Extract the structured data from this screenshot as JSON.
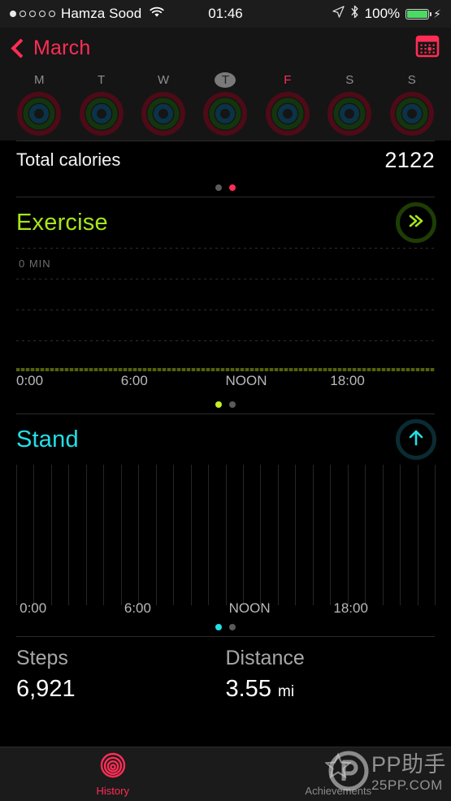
{
  "status_bar": {
    "signal_dots_filled": 1,
    "signal_dots_total": 5,
    "carrier": "Hamza Sood",
    "wifi_icon": "wifi-icon",
    "time": "01:46",
    "location_icon": "location-arrow-icon",
    "bluetooth_icon": "bluetooth-icon",
    "battery_percent": "100%",
    "battery_fill": 100,
    "battery_color": "#4cd964",
    "charging": true
  },
  "nav_bar": {
    "back_icon": "chevron-left-icon",
    "back_label": "March",
    "calendar_icon": "calendar-icon",
    "accent_color": "#ff2d55"
  },
  "week_strip": {
    "days": [
      {
        "letter": "M",
        "selected": false,
        "highlighted": false
      },
      {
        "letter": "T",
        "selected": false,
        "highlighted": false
      },
      {
        "letter": "W",
        "selected": false,
        "highlighted": false
      },
      {
        "letter": "T",
        "selected": true,
        "highlighted": false
      },
      {
        "letter": "F",
        "selected": false,
        "highlighted": true
      },
      {
        "letter": "S",
        "selected": false,
        "highlighted": false
      },
      {
        "letter": "S",
        "selected": false,
        "highlighted": false
      }
    ],
    "ring_track_colors": {
      "move": "#4d0a17",
      "exercise": "#13350d",
      "stand": "#0b3347"
    }
  },
  "move_section": {
    "total_label": "Total calories",
    "total_value": "2122",
    "page_dots": [
      {
        "active": false,
        "color": "#5a5a5a"
      },
      {
        "active": true,
        "color": "#ff2d55"
      }
    ]
  },
  "exercise_section": {
    "title": "Exercise",
    "title_color": "#a6e619",
    "badge_icon": "double-chevron-right-icon",
    "badge_color": "#a6e619",
    "zero_label": "0 MIN",
    "axis_labels": [
      "0:00",
      "6:00",
      "NOON",
      "18:00"
    ],
    "page_dots": [
      {
        "active": true,
        "color": "#c4f022"
      },
      {
        "active": false,
        "color": "#5a5a5a"
      }
    ]
  },
  "stand_section": {
    "title": "Stand",
    "title_color": "#22dfe6",
    "badge_icon": "arrow-up-icon",
    "badge_color": "#22dfe6",
    "axis_labels": [
      "0:00",
      "6:00",
      "NOON",
      "18:00"
    ],
    "page_dots": [
      {
        "active": true,
        "color": "#22dfe6"
      },
      {
        "active": false,
        "color": "#5a5a5a"
      }
    ]
  },
  "stats": [
    {
      "label": "Steps",
      "value": "6,921",
      "unit": ""
    },
    {
      "label": "Distance",
      "value": "3.55",
      "unit": "mi"
    }
  ],
  "tab_bar": {
    "tabs": [
      {
        "label": "History",
        "icon": "activity-spiral-icon",
        "active": true,
        "color": "#ff2d55"
      },
      {
        "label": "Achievements",
        "icon": "star-icon",
        "active": false,
        "color": "#8a8a8a"
      }
    ]
  },
  "watermark": {
    "logo_icon": "pp-logo-icon",
    "line1": "PP助手",
    "line2": "25PP.COM"
  },
  "chart_data": [
    {
      "type": "bar",
      "title": "Exercise",
      "xlabel": "",
      "ylabel": "MIN",
      "x": [
        "0:00",
        "6:00",
        "NOON",
        "18:00"
      ],
      "xlim": [
        0,
        24
      ],
      "ylim": [
        0,
        60
      ],
      "ytick_labels": [
        "0 MIN"
      ],
      "grid": true,
      "gridlines": 5,
      "values": [
        0,
        0,
        0,
        0,
        0,
        0,
        0,
        0,
        0,
        0,
        0,
        0,
        0,
        0,
        0,
        0,
        0,
        0,
        0,
        0,
        0,
        0,
        0,
        0
      ],
      "legend": ""
    },
    {
      "type": "bar",
      "title": "Stand",
      "xlabel": "",
      "ylabel": "",
      "x": [
        "0:00",
        "6:00",
        "NOON",
        "18:00"
      ],
      "xlim": [
        0,
        24
      ],
      "ylim": [
        0,
        1
      ],
      "grid": true,
      "gridlines": 24,
      "values": [
        0,
        0,
        0,
        0,
        0,
        0,
        0,
        0,
        0,
        0,
        0,
        0,
        0,
        0,
        0,
        0,
        0,
        0,
        0,
        0,
        0,
        0,
        0,
        0
      ],
      "legend": ""
    }
  ]
}
